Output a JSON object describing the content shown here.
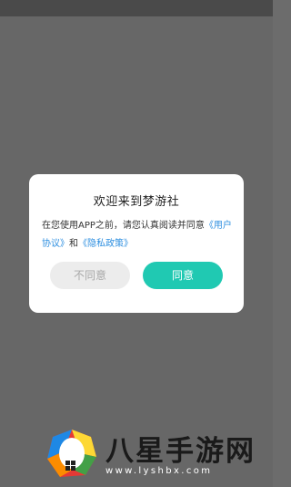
{
  "dialog": {
    "title": "欢迎来到梦游社",
    "body_text": "在您使用APP之前，请您认真阅读并同意",
    "user_agreement_link": "《用户协议》",
    "conjunction": "和",
    "privacy_policy_link": "《隐私政策》",
    "disagree_label": "不同意",
    "agree_label": "同意"
  },
  "watermark": {
    "title": "八星手游网",
    "url": "www.lyshbx.com"
  },
  "colors": {
    "accent": "#20c9b2",
    "link": "#2e8fe0",
    "overlay": "#676767"
  }
}
